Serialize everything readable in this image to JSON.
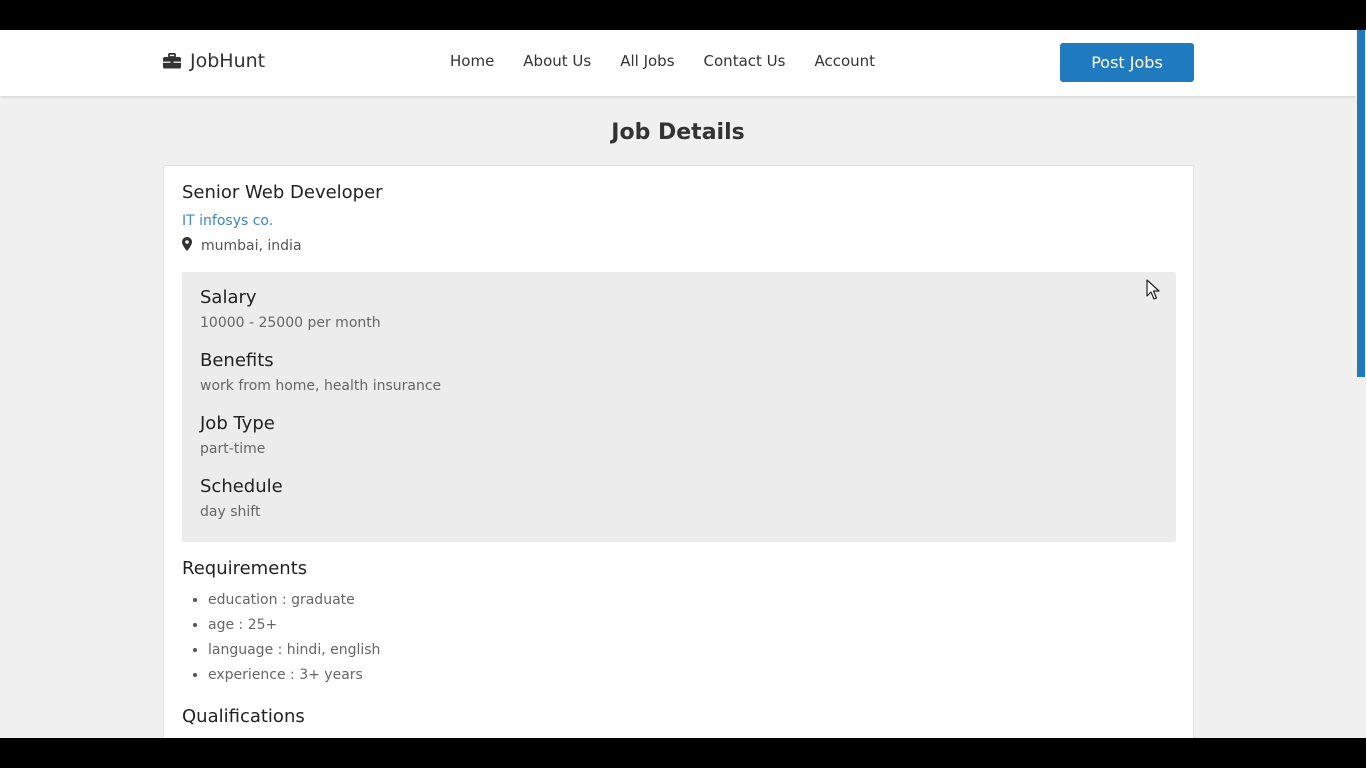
{
  "brand": {
    "name": "JobHunt",
    "icon": "briefcase-icon"
  },
  "nav": [
    {
      "label": "Home"
    },
    {
      "label": "About Us"
    },
    {
      "label": "All Jobs"
    },
    {
      "label": "Contact Us"
    },
    {
      "label": "Account"
    }
  ],
  "post_button": "Post Jobs",
  "page_title": "Job Details",
  "job": {
    "title": "Senior Web Developer",
    "category": "IT",
    "company": "infosys co.",
    "location": "mumbai, india",
    "location_icon": "map-marker-icon"
  },
  "details": [
    {
      "label": "Salary",
      "value": "10000 - 25000 per month"
    },
    {
      "label": "Benefits",
      "value": "work from home, health insurance"
    },
    {
      "label": "Job Type",
      "value": "part-time"
    },
    {
      "label": "Schedule",
      "value": "day shift"
    }
  ],
  "requirements": {
    "title": "Requirements",
    "items": [
      "education : graduate",
      "age : 25+",
      "language : hindi, english",
      "experience : 3+ years"
    ]
  },
  "qualifications": {
    "title": "Qualifications"
  },
  "colors": {
    "accent": "#1f7ac0",
    "link": "#3a88c6",
    "page_bg": "#f0f0f0",
    "info_bg": "#ececec"
  }
}
